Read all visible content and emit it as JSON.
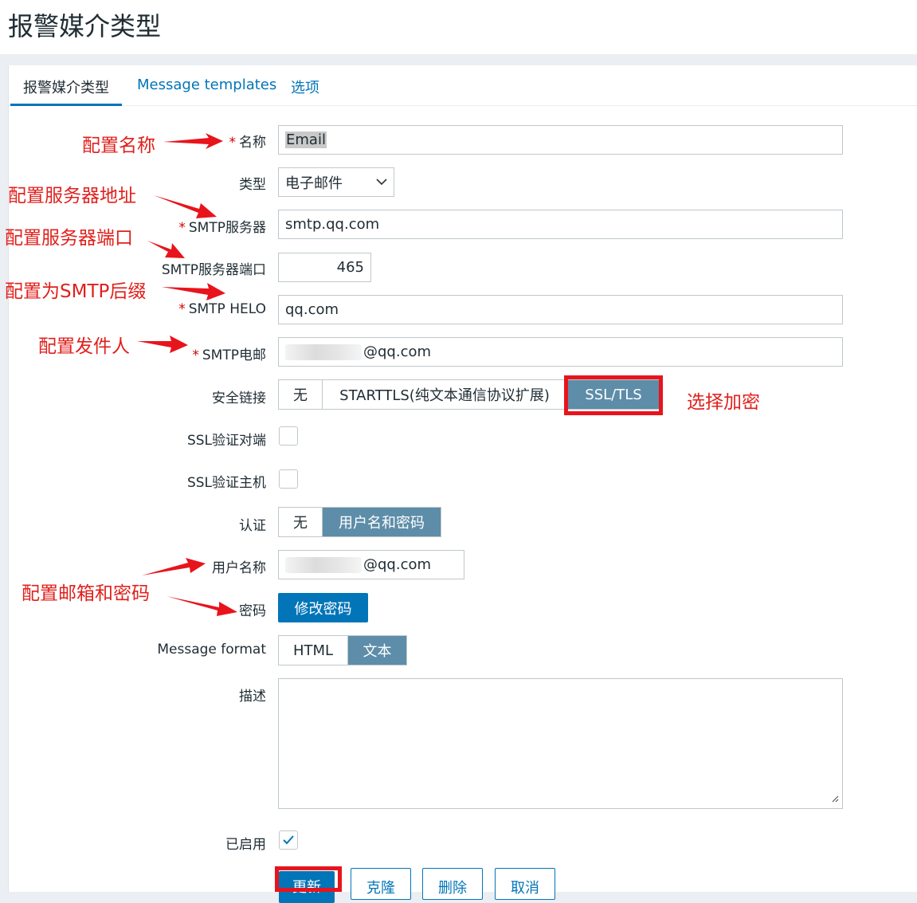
{
  "page": {
    "title": "报警媒介类型"
  },
  "tabs": [
    {
      "label": "报警媒介类型"
    },
    {
      "label": "Message templates"
    },
    {
      "label": "选项"
    }
  ],
  "form": {
    "name": {
      "label": "名称",
      "value": "Email"
    },
    "type": {
      "label": "类型",
      "value": "电子邮件"
    },
    "smtp_server": {
      "label": "SMTP服务器",
      "value": "smtp.qq.com"
    },
    "smtp_port": {
      "label": "SMTP服务器端口",
      "value": "465"
    },
    "smtp_helo": {
      "label": "SMTP HELO",
      "value": "qq.com"
    },
    "smtp_email": {
      "label": "SMTP电邮",
      "value": "@qq.com"
    },
    "security": {
      "label": "安全链接",
      "options": [
        "无",
        "STARTTLS(纯文本通信协议扩展)",
        "SSL/TLS"
      ],
      "selected": "SSL/TLS"
    },
    "ssl_verify_peer": {
      "label": "SSL验证对端",
      "checked": false
    },
    "ssl_verify_host": {
      "label": "SSL验证主机",
      "checked": false
    },
    "auth": {
      "label": "认证",
      "options": [
        "无",
        "用户名和密码"
      ],
      "selected": "用户名和密码"
    },
    "username": {
      "label": "用户名称",
      "value": "@qq.com"
    },
    "password": {
      "label": "密码",
      "button": "修改密码"
    },
    "message_format": {
      "label": "Message format",
      "options": [
        "HTML",
        "文本"
      ],
      "selected": "文本"
    },
    "description": {
      "label": "描述",
      "value": ""
    },
    "enabled": {
      "label": "已启用",
      "checked": true
    }
  },
  "buttons": {
    "update": "更新",
    "clone": "克隆",
    "delete": "删除",
    "cancel": "取消"
  },
  "annotations": {
    "name": "配置名称",
    "server": "配置服务器地址",
    "port": "配置服务器端口",
    "helo": "配置为SMTP后缀",
    "sender": "配置发件人",
    "encryption": "选择加密",
    "credentials": "配置邮箱和密码"
  },
  "colors": {
    "link": "#0275b8",
    "segment_on": "#5d8da8",
    "annotation": "#e0201c"
  },
  "icons": {
    "select": "chevron-down-icon",
    "enabled": "checkmark-icon",
    "resize": "resize-handle-icon"
  }
}
